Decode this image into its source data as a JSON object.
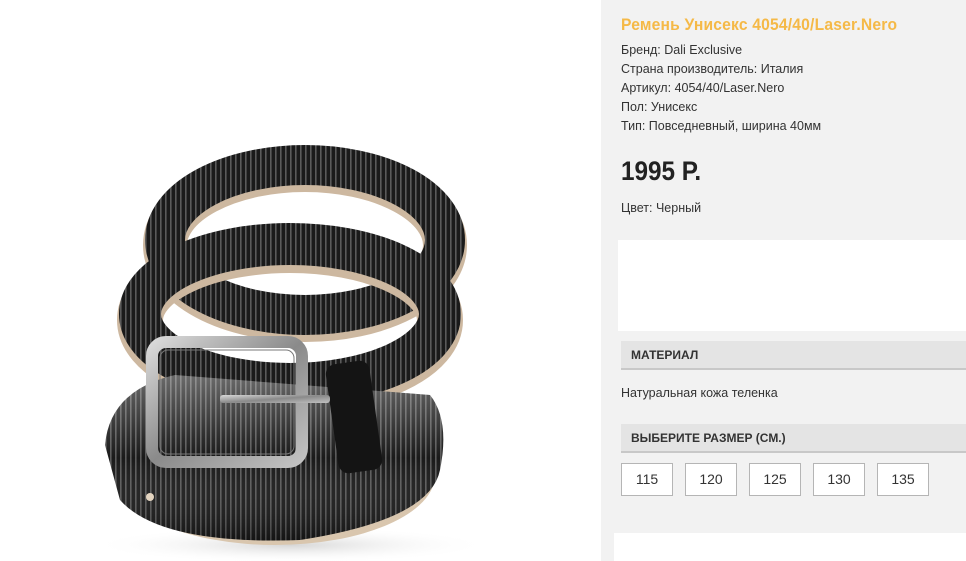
{
  "product": {
    "title": "Ремень Унисекс 4054/40/Laser.Nero",
    "specs": [
      {
        "label": "Бренд:",
        "value": "Dali Exclusive"
      },
      {
        "label": "Страна производитель:",
        "value": "Италия"
      },
      {
        "label": "Артикул:",
        "value": "4054/40/Laser.Nero"
      },
      {
        "label": "Пол:",
        "value": "Унисекс"
      },
      {
        "label": "Тип:",
        "value": "Повседневный, ширина 40мм"
      }
    ],
    "price": "1995 Р.",
    "color": "Цвет: Черный"
  },
  "material": {
    "heading": "МАТЕРИАЛ",
    "text": "Натуральная кожа теленка"
  },
  "size_select": {
    "heading": "ВЫБЕРИТЕ РАЗМЕР (СМ.)",
    "options": [
      "115",
      "120",
      "125",
      "130",
      "135"
    ]
  },
  "colors": {
    "title": "#f5b947",
    "panel_bg": "#f2f2f2",
    "section_bg": "#e4e4e4"
  }
}
